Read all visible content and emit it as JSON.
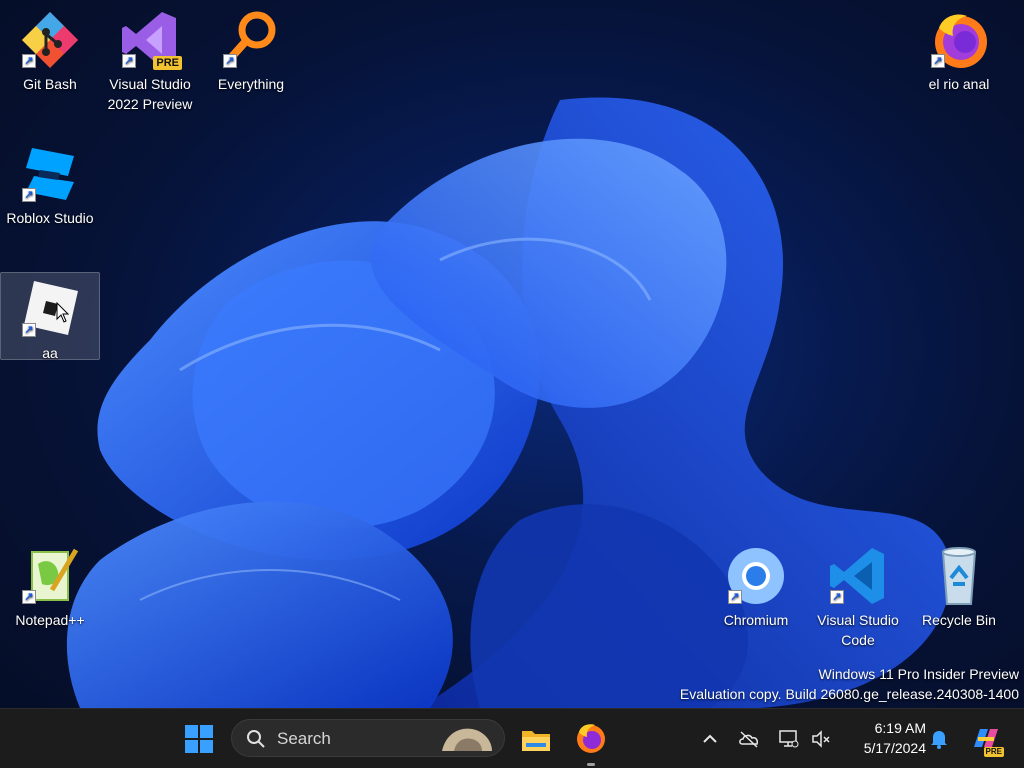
{
  "desktop": {
    "icons": [
      {
        "label": "Git Bash",
        "icon": "git-bash-icon"
      },
      {
        "label": "Visual Studio 2022 Preview",
        "icon": "visual-studio-preview-icon",
        "badge": "PRE"
      },
      {
        "label": "Everything",
        "icon": "everything-search-icon"
      },
      {
        "label": "el rio anal",
        "icon": "firefox-icon"
      },
      {
        "label": "Roblox Studio",
        "icon": "roblox-studio-icon"
      },
      {
        "label": "aa",
        "icon": "roblox-icon"
      },
      {
        "label": "Notepad++",
        "icon": "notepad-plus-plus-icon"
      },
      {
        "label": "Chromium",
        "icon": "chromium-icon"
      },
      {
        "label": "Visual Studio Code",
        "icon": "vscode-icon"
      },
      {
        "label": "Recycle Bin",
        "icon": "recycle-bin-icon"
      }
    ]
  },
  "watermark": {
    "line1": "Windows 11 Pro Insider Preview",
    "line2": "Evaluation copy. Build 26080.ge_release.240308-1400"
  },
  "taskbar": {
    "search_placeholder": "Search",
    "pinned": [
      "start-icon",
      "search",
      "file-explorer-icon",
      "firefox-icon"
    ],
    "tray": [
      "chevron-up-icon",
      "onedrive-off-icon",
      "network-icon",
      "volume-muted-icon"
    ],
    "time": "6:19 AM",
    "date": "5/17/2024",
    "copilot_badge": "PRE"
  },
  "colors": {
    "accent": "#1a6cff",
    "taskbar_bg": "#1c1c1c",
    "wallpaper_deep": "#061236"
  }
}
